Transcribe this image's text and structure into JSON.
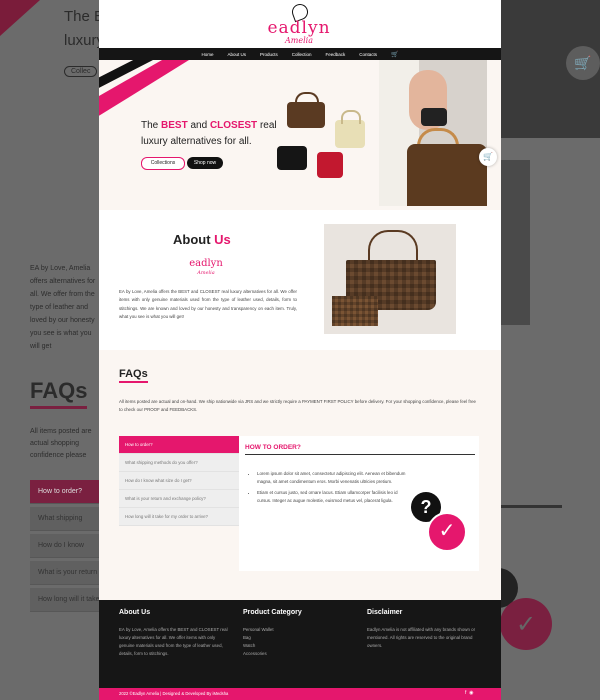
{
  "header": {
    "logo_word": "eadlyn",
    "logo_sub": "Amelia"
  },
  "nav": {
    "items": [
      "Home",
      "About Us",
      "Products",
      "Collection",
      "Feedback",
      "Contacts"
    ],
    "cart_icon": "cart-icon"
  },
  "hero": {
    "title_prefix": "The ",
    "title_best": "BEST",
    "title_and": " and ",
    "title_closest": "CLOSEST",
    "title_rest": " real luxury alternatives for all.",
    "collections_button": "Collections",
    "shop_button": "Shop now"
  },
  "about": {
    "title_main": "About",
    "title_accent": "Us",
    "logo_word": "eadlyn",
    "logo_sub": "Amelia",
    "text": "EA by Love, Amelia offers the BEST and CLOSEST real luxury alternatives for all. We offer items with only genuine materials used from the type of leather used, details, form to stitchings. We are known and loved by our honesty and transparency on each item. Truly, what you see is what you will get!"
  },
  "faq": {
    "title": "FAQs",
    "description": "All items posted are actual and on-hand. We ship nationwide via JRS and we strictly require a PAYMENT FIRST POLICY before delivery. For your shopping confidence, please feel free to check our PROOF and FEEDBACKS.",
    "questions": [
      "How to order?",
      "What shipping methods do you offer?",
      "How do I know what size do I get?",
      "What is your return and exchange policy?",
      "How long will it take for my order to arrive?"
    ],
    "panel_title": "HOW TO ORDER?",
    "bullets": [
      "Lorem ipsum dolor sit amet, consectetur adipiscing elit. Aenean et bibendum magna, sit amet condimentum eros. Morbi venenatis ultricies pretium.",
      "Etiam et cursus justo, sed ornare lacus. Etiam ullamcorper facilisis leo id cursus. Integer ac augue molestie, euismod metus vel, placerat ligula."
    ]
  },
  "footer": {
    "about_title": "About Us",
    "about_text": "EA by Love, Amelia offers the BEST and CLOSEST real luxury alternatives for all. We offer items with only genuine materials used from the type of leather used, details, form to stitchings.",
    "category_title": "Product Category",
    "categories": [
      "Personal Wallet",
      "Bag",
      "Watch",
      "Accessories"
    ],
    "disclaimer_title": "Disclaimer",
    "disclaimer_text": "Eadlyn Amelia is not affiliated with any brands shown or mentioned. All rights are reserved to the original brand owners.",
    "copyright": "2022 ©Eadlyn Amelia | Designed & Developed By iMedsha"
  },
  "background": {
    "title_line1": "The B",
    "title_line2": "luxury",
    "collections_fragment": "Collec",
    "faq_title": "FAQs",
    "para_fragment": "EA by Love, Amelia offers alternatives for all. We offer from the type of leather and loved by our honesty you see is what you will get",
    "para2_fragment": "All items posted are actual shopping confidence please",
    "active_question": "How to order?",
    "q2": "What shipping methods",
    "q3": "How do I know what",
    "q4": "What is your return",
    "q5": "How long will it take"
  },
  "colors": {
    "accent": "#e5176d",
    "dark": "#151515",
    "cream": "#fbf6f2"
  }
}
